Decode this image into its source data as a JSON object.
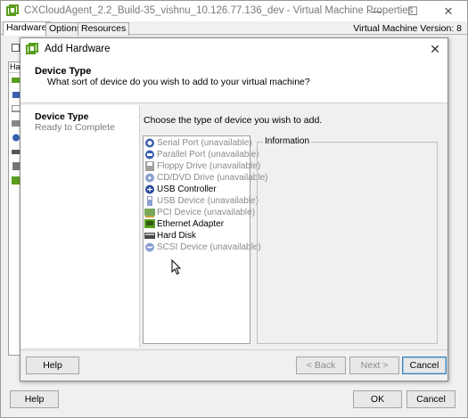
{
  "outer_window": {
    "title": "CXCloudAgent_2.2_Build-35_vishnu_10.126.77.136_dev - Virtual Machine Properties",
    "tabs": [
      {
        "label": "Hardware",
        "active": true
      },
      {
        "label": "Options",
        "active": false
      },
      {
        "label": "Resources",
        "active": false
      }
    ],
    "vm_version": "Virtual Machine Version: 8",
    "sidebar_header": "Har",
    "controls": {
      "minimize": "—",
      "maximize": "☐",
      "close": "✕"
    },
    "buttons": {
      "help": "Help",
      "ok": "OK",
      "cancel": "Cancel"
    }
  },
  "dialog": {
    "title": "Add Hardware",
    "close_glyph": "✕",
    "header_title": "Device Type",
    "header_subtitle": "What sort of device do you wish to add to your virtual machine?",
    "steps": [
      {
        "label": "Device Type",
        "state": "current"
      },
      {
        "label": "Ready to Complete",
        "state": "pending"
      }
    ],
    "instruction": "Choose the type of device you wish to add.",
    "devices": [
      {
        "label": "Serial Port (unavailable)",
        "icon": "serial-port-icon",
        "enabled": false
      },
      {
        "label": "Parallel Port (unavailable)",
        "icon": "parallel-port-icon",
        "enabled": false
      },
      {
        "label": "Floppy Drive (unavailable)",
        "icon": "floppy-drive-icon",
        "enabled": false
      },
      {
        "label": "CD/DVD Drive (unavailable)",
        "icon": "cd-dvd-drive-icon",
        "enabled": false
      },
      {
        "label": "USB Controller",
        "icon": "usb-controller-icon",
        "enabled": true
      },
      {
        "label": "USB Device (unavailable)",
        "icon": "usb-device-icon",
        "enabled": false
      },
      {
        "label": "PCI Device (unavailable)",
        "icon": "pci-device-icon",
        "enabled": false
      },
      {
        "label": "Ethernet Adapter",
        "icon": "ethernet-adapter-icon",
        "enabled": true
      },
      {
        "label": "Hard Disk",
        "icon": "hard-disk-icon",
        "enabled": true
      },
      {
        "label": "SCSI Device (unavailable)",
        "icon": "scsi-device-icon",
        "enabled": false
      }
    ],
    "info_title": "Information",
    "buttons": {
      "help": "Help",
      "back": "< Back",
      "next": "Next >",
      "cancel": "Cancel"
    }
  },
  "colors": {
    "window_bg": "#f0f0f0",
    "panel_bg": "#ffffff",
    "disabled_text": "#8a8a8a",
    "vm_green": "#5a9e1e",
    "icon_blue": "#3a5fb0"
  }
}
